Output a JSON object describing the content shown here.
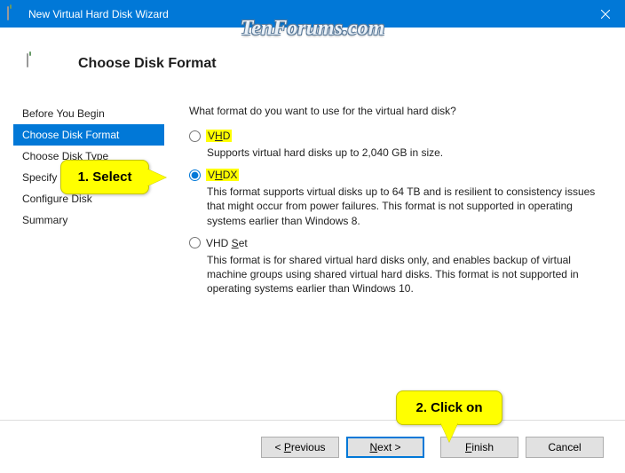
{
  "titlebar": {
    "title": "New Virtual Hard Disk Wizard"
  },
  "watermark": "TenForums.com",
  "header": {
    "title": "Choose Disk Format"
  },
  "sidebar": {
    "steps": [
      {
        "label": "Before You Begin"
      },
      {
        "label": "Choose Disk Format"
      },
      {
        "label": "Choose Disk Type"
      },
      {
        "label": "Specify Na"
      },
      {
        "label": "Configure Disk"
      },
      {
        "label": "Summary"
      }
    ]
  },
  "content": {
    "question": "What format do you want to use for the virtual hard disk?",
    "options": {
      "vhd": {
        "label_prefix": "V",
        "label_u": "H",
        "label_suffix": "D",
        "desc": "Supports virtual hard disks up to 2,040 GB in size."
      },
      "vhdx": {
        "label_prefix": "V",
        "label_u": "H",
        "label_suffix": "DX",
        "desc": "This format supports virtual disks up to 64 TB and is resilient to consistency issues that might occur from power failures. This format is not supported in operating systems earlier than Windows 8."
      },
      "vhdset": {
        "label_prefix": "VHD ",
        "label_u": "S",
        "label_suffix": "et",
        "desc": "This format is for shared virtual hard disks only, and enables backup of virtual machine groups using shared virtual hard disks. This format is not supported in operating systems earlier than Windows 10."
      }
    }
  },
  "footer": {
    "previous_lt": "< ",
    "previous_u": "P",
    "previous_suffix": "revious",
    "next_u": "N",
    "next_suffix": "ext >",
    "finish_u": "F",
    "finish_suffix": "inish",
    "cancel": "Cancel"
  },
  "callouts": {
    "c1": "1. Select",
    "c2": "2. Click on"
  }
}
